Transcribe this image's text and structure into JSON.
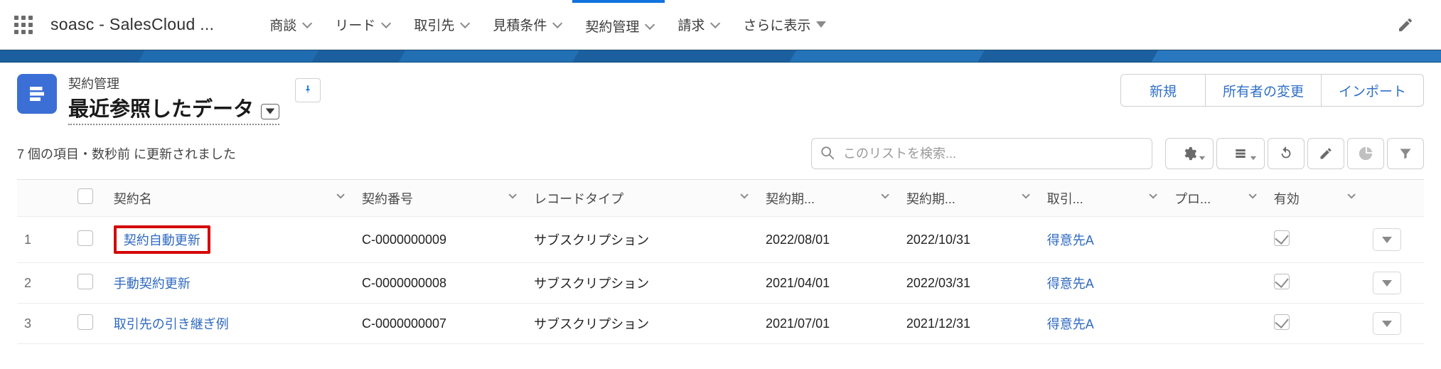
{
  "app_title": "soasc - SalesCloud ...",
  "nav": {
    "items": [
      {
        "label": "商談"
      },
      {
        "label": "リード"
      },
      {
        "label": "取引先"
      },
      {
        "label": "見積条件"
      },
      {
        "label": "契約管理",
        "active": true
      },
      {
        "label": "請求"
      },
      {
        "label": "さらに表示",
        "more": true
      }
    ]
  },
  "object": {
    "label": "契約管理",
    "list_view": "最近参照したデータ",
    "status": "7 個の項目・数秒前 に更新されました"
  },
  "header_actions": {
    "new": "新規",
    "change_owner": "所有者の変更",
    "import": "インポート"
  },
  "search": {
    "placeholder": "このリストを検索..."
  },
  "columns": {
    "name": "契約名",
    "number": "契約番号",
    "record_type": "レコードタイプ",
    "start": "契約期...",
    "end": "契約期...",
    "account": "取引...",
    "process": "プロ...",
    "valid": "有効"
  },
  "rows": [
    {
      "num": "1",
      "name": "契約自動更新",
      "emph": true,
      "number": "C-0000000009",
      "type": "サブスクリプション",
      "start": "2022/08/01",
      "end": "2022/10/31",
      "account": "得意先A",
      "valid": true
    },
    {
      "num": "2",
      "name": "手動契約更新",
      "number": "C-0000000008",
      "type": "サブスクリプション",
      "start": "2021/04/01",
      "end": "2022/03/31",
      "account": "得意先A",
      "valid": true
    },
    {
      "num": "3",
      "name": "取引先の引き継ぎ例",
      "number": "C-0000000007",
      "type": "サブスクリプション",
      "start": "2021/07/01",
      "end": "2021/12/31",
      "account": "得意先A",
      "valid": true
    }
  ]
}
